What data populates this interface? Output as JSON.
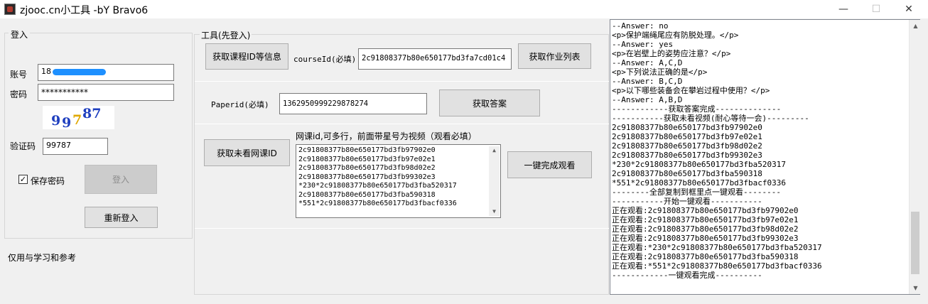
{
  "window": {
    "title": "zjooc.cn小工具 -bY Bravo6",
    "minimize": "—",
    "maximize": "☐",
    "close": "✕"
  },
  "login": {
    "group_title": "登入",
    "account_label": "账号",
    "account_value": "18",
    "password_label": "密码",
    "password_value": "***********",
    "captcha_image_text": [
      "9",
      "9",
      "7",
      "87"
    ],
    "captcha_label": "验证码",
    "captcha_value": "99787",
    "save_password_label": "保存密码",
    "save_password_checked": true,
    "login_button": "登入",
    "relogin_button": "重新登入",
    "footer_note": "仅用与学习和参考"
  },
  "tools": {
    "group_title": "工具(先登入)",
    "get_course_button": "获取课程ID等信息",
    "course_id_label": "courseId(必填)",
    "course_id_value": "2c91808377b80e650177bd3fa7cd01c4",
    "get_homework_button": "获取作业列表",
    "paper_id_label": "Paperid(必填)",
    "paper_id_value": "1362950999229878274",
    "get_answer_button": "获取答案",
    "get_unwatched_button": "获取未看网课ID",
    "lesson_ids_label": "网课id,可多行，前面带星号为视频（观看必填）",
    "lesson_ids": [
      "2c91808377b80e650177bd3fb97902e0",
      "2c91808377b80e650177bd3fb97e02e1",
      "2c91808377b80e650177bd3fb98d02e2",
      "2c91808377b80e650177bd3fb99302e3",
      "*230*2c91808377b80e650177bd3fba520317",
      "2c91808377b80e650177bd3fba590318",
      "*551*2c91808377b80e650177bd3fbacf0336"
    ],
    "watch_all_button": "一键完成观看"
  },
  "log": {
    "lines": [
      "--Answer: no",
      "<p>保护端绳尾应有防脱处理。</p>",
      "--Answer: yes",
      "<p>在岩壁上的姿势应注意？</p>",
      "--Answer: A,C,D",
      "<p>下列说法正确的是</p>",
      "--Answer: B,C,D",
      "<p>以下哪些装备会在攀岩过程中使用？</p>",
      "--Answer: A,B,D",
      "------------获取答案完成--------------",
      "-----------获取未看视频(耐心等待一会)---------",
      "2c91808377b80e650177bd3fb97902e0",
      "2c91808377b80e650177bd3fb97e02e1",
      "2c91808377b80e650177bd3fb98d02e2",
      "2c91808377b80e650177bd3fb99302e3",
      "*230*2c91808377b80e650177bd3fba520317",
      "2c91808377b80e650177bd3fba590318",
      "*551*2c91808377b80e650177bd3fbacf0336",
      "--------全部复制到框里点一键观看--------",
      "-----------开始一键观看-----------",
      "正在观看:2c91808377b80e650177bd3fb97902e0",
      "正在观看:2c91808377b80e650177bd3fb97e02e1",
      "正在观看:2c91808377b80e650177bd3fb98d02e2",
      "正在观看:2c91808377b80e650177bd3fb99302e3",
      "正在观看:*230*2c91808377b80e650177bd3fba520317",
      "正在观看:2c91808377b80e650177bd3fba590318",
      "正在观看:*551*2c91808377b80e650177bd3fbacf0336",
      "------------一键观看完成----------"
    ]
  },
  "colors": {
    "captcha_blue": "#1f3fbf",
    "captcha_yellow": "#e0a800",
    "redaction_blue": "#1e90ff"
  }
}
